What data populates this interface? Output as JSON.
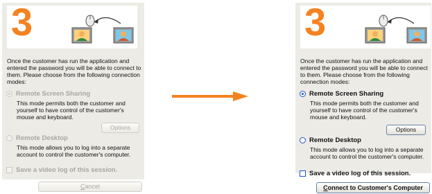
{
  "step_number": "3",
  "intro_text": "Once the customer has run the application and entered the password you will be able to connect to them.   Please choose from the following connection modes:",
  "options": {
    "remote_screen_sharing": {
      "label": "Remote Screen Sharing",
      "description": "This mode permits both the customer and yourself to have control of the customer's mouse and keyboard."
    },
    "remote_desktop": {
      "label": "Remote Desktop",
      "description": "This mode allows you to log into a separate account to control the customer's computer."
    }
  },
  "options_button": "Options",
  "video_log_label": "Save a video log of this session.",
  "left_panel": {
    "bottom_button": "Cancel",
    "state": "disabled"
  },
  "right_panel": {
    "bottom_button": "Connect to Customer's Computer",
    "state": "enabled"
  },
  "icons": [
    "step-illustration-icon",
    "computer-user-icon",
    "mouse-icon",
    "arrow-right-icon"
  ],
  "colors": {
    "step_number": "#f58220",
    "arrow": "#f58220",
    "panel_bg": "#ecebe6",
    "accent": "#1e50d2"
  }
}
